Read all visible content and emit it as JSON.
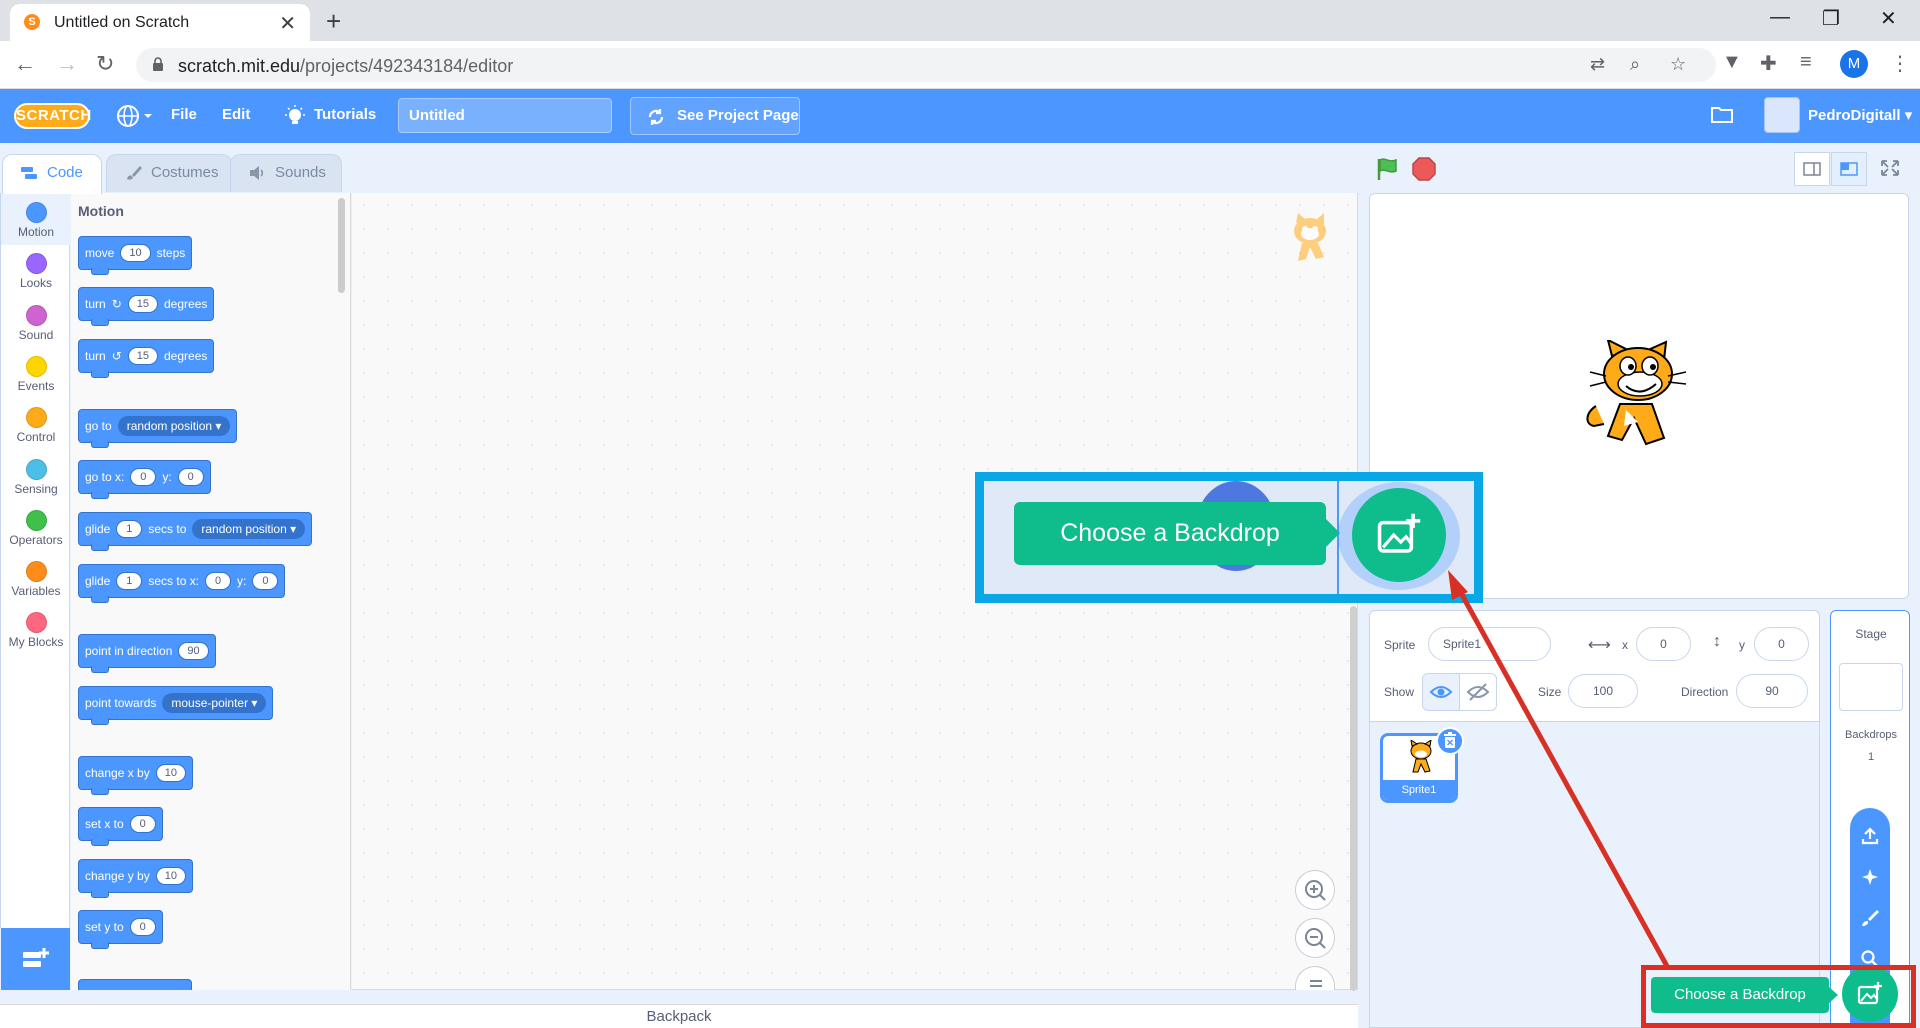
{
  "browser": {
    "tab_title": "Untitled on Scratch",
    "tab_favicon": "S",
    "url_host": "scratch.mit.edu",
    "url_path": "/projects/492343184/editor",
    "profile_initial": "M"
  },
  "menubar": {
    "logo": "SCRATCH",
    "file": "File",
    "edit": "Edit",
    "tutorials": "Tutorials",
    "project_title": "Untitled",
    "see_project_page": "See Project Page",
    "username": "PedroDigitall"
  },
  "editor_tabs": {
    "code": "Code",
    "costumes": "Costumes",
    "sounds": "Sounds"
  },
  "categories": [
    {
      "label": "Motion",
      "color": "#4c97ff"
    },
    {
      "label": "Looks",
      "color": "#9966ff"
    },
    {
      "label": "Sound",
      "color": "#cf63cf"
    },
    {
      "label": "Events",
      "color": "#ffd500"
    },
    {
      "label": "Control",
      "color": "#ffab19"
    },
    {
      "label": "Sensing",
      "color": "#4cbfe6"
    },
    {
      "label": "Operators",
      "color": "#40bf4a"
    },
    {
      "label": "Variables",
      "color": "#ff8c1a"
    },
    {
      "label": "My Blocks",
      "color": "#ff6680"
    }
  ],
  "palette": {
    "heading": "Motion",
    "blocks": {
      "move": {
        "a": "move",
        "v": "10",
        "b": "steps"
      },
      "turn_right": {
        "a": "turn",
        "v": "15",
        "b": "degrees"
      },
      "turn_left": {
        "a": "turn",
        "v": "15",
        "b": "degrees"
      },
      "goto": {
        "a": "go to",
        "dd": "random position"
      },
      "goto_xy": {
        "a": "go to x:",
        "x": "0",
        "b": "y:",
        "y": "0"
      },
      "glide_to": {
        "a": "glide",
        "v": "1",
        "b": "secs to",
        "dd": "random position"
      },
      "glide_xy": {
        "a": "glide",
        "v": "1",
        "b": "secs to x:",
        "x": "0",
        "c": "y:",
        "y": "0"
      },
      "point_dir": {
        "a": "point in direction",
        "v": "90"
      },
      "point_towards": {
        "a": "point towards",
        "dd": "mouse-pointer"
      },
      "change_x": {
        "a": "change x by",
        "v": "10"
      },
      "set_x": {
        "a": "set x to",
        "v": "0"
      },
      "change_y": {
        "a": "change y by",
        "v": "10"
      },
      "set_y": {
        "a": "set y to",
        "v": "0"
      }
    }
  },
  "backpack": "Backpack",
  "sprite_info": {
    "sprite_label": "Sprite",
    "sprite_name": "Sprite1",
    "x_label": "x",
    "x_value": "0",
    "y_label": "y",
    "y_value": "0",
    "show_label": "Show",
    "size_label": "Size",
    "size_value": "100",
    "direction_label": "Direction",
    "direction_value": "90"
  },
  "sprites": [
    {
      "name": "Sprite1"
    }
  ],
  "stage_panel": {
    "title": "Stage",
    "backdrops_label": "Backdrops",
    "backdrops_count": "1"
  },
  "tooltip": {
    "small": "Choose a Backdrop",
    "zoomed": "Choose a Backdrop"
  },
  "colors": {
    "scratch_blue": "#4c97ff",
    "add_button_green": "#0fbd8c",
    "annotation_red": "#d93025",
    "annotation_blue": "#0aa7e6"
  }
}
